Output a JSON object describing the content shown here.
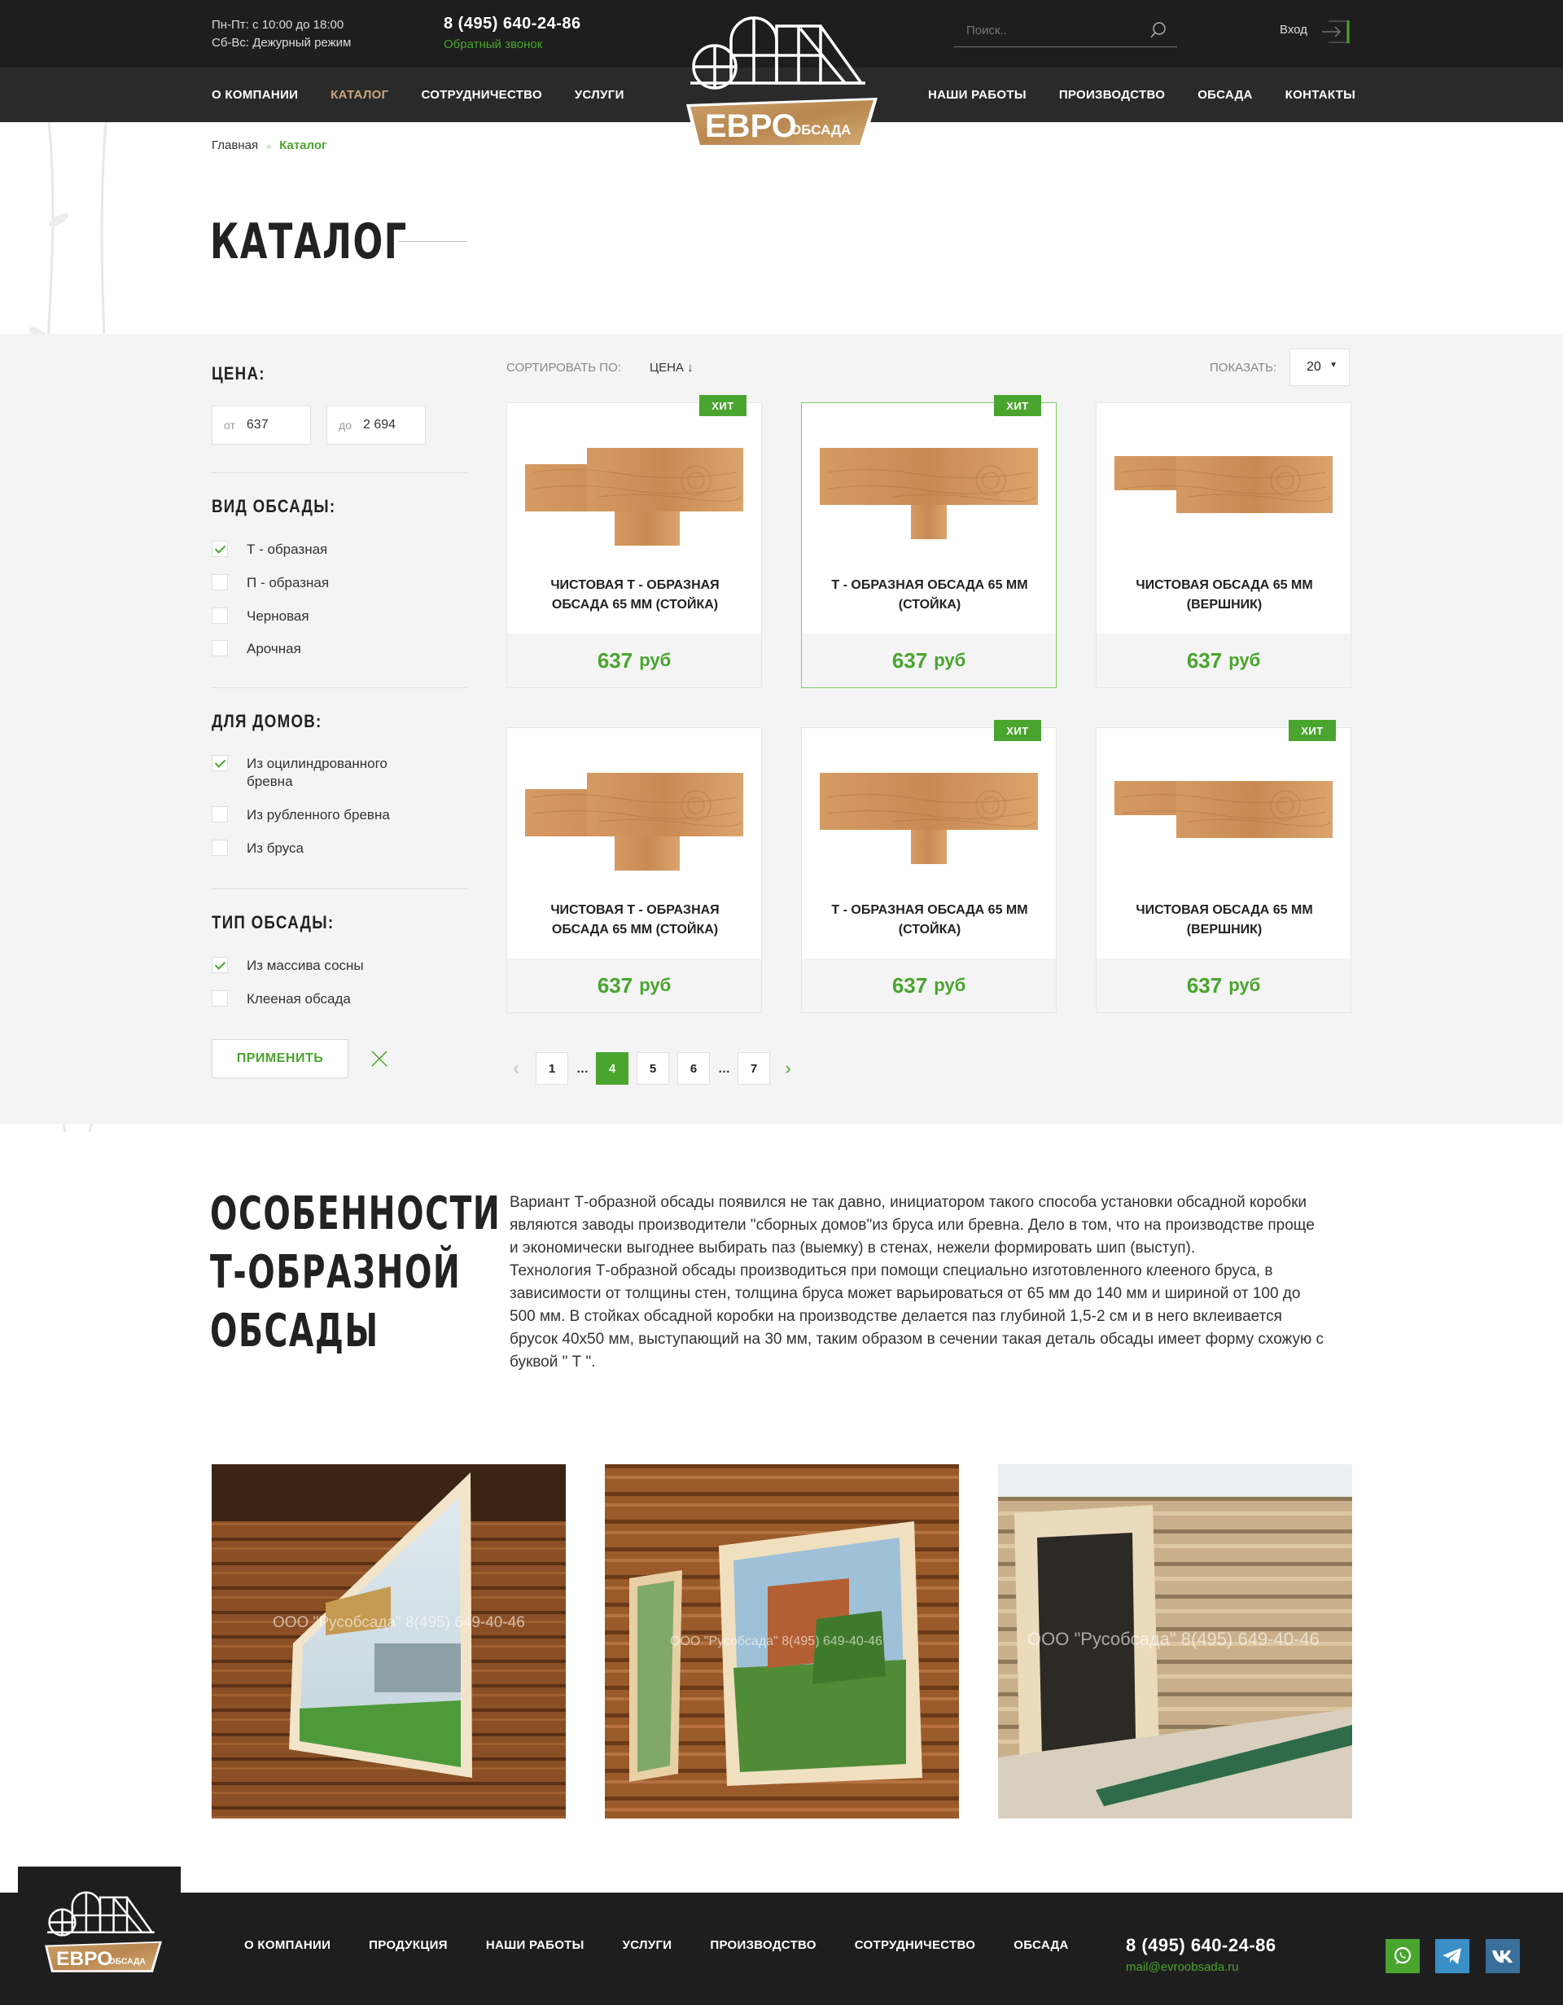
{
  "header": {
    "hours_weekdays": "Пн-Пт: с 10:00 до 18:00",
    "hours_weekend": "Сб-Вс: Дежурный режим",
    "phone": "8 (495) 640-24-86",
    "callback": "Обратный звонок",
    "search_placeholder": "Поиск..",
    "login": "Вход",
    "logo_main": "ЕВРО",
    "logo_sub": "ОБСАДА",
    "nav_left": [
      "О КОМПАНИИ",
      "КАТАЛОГ",
      "СОТРУДНИЧЕСТВО",
      "УСЛУГИ"
    ],
    "nav_right": [
      "НАШИ РАБОТЫ",
      "ПРОИЗВОДСТВО",
      "ОБСАДА",
      "КОНТАКТЫ"
    ]
  },
  "breadcrumb": {
    "home": "Главная",
    "current": "Каталог"
  },
  "page_title": "КАТАЛОГ",
  "filters": {
    "price_title": "ЦЕНА:",
    "price_from_label": "от",
    "price_from": "637",
    "price_to_label": "до",
    "price_to": "2 694",
    "type_title": "ВИД ОБСАДЫ:",
    "type_options": [
      {
        "label": "Т - образная",
        "checked": true
      },
      {
        "label": "П - образная",
        "checked": false
      },
      {
        "label": "Черновая",
        "checked": false
      },
      {
        "label": "Арочная",
        "checked": false
      }
    ],
    "house_title": "ДЛЯ ДОМОВ:",
    "house_options": [
      {
        "label": "Из оцилиндрованного бревна",
        "checked": true
      },
      {
        "label": "Из рубленного бревна",
        "checked": false
      },
      {
        "label": "Из бруса",
        "checked": false
      }
    ],
    "kind_title": "ТИП ОБСАДЫ:",
    "kind_options": [
      {
        "label": "Из массива сосны",
        "checked": true
      },
      {
        "label": "Клееная обсада",
        "checked": false
      }
    ],
    "apply": "ПРИМЕНИТЬ"
  },
  "sort": {
    "label": "СОРТИРОВАТЬ ПО:",
    "value": "ЦЕНА ↓"
  },
  "show": {
    "label": "ПОКАЗАТЬ:",
    "value": "20"
  },
  "products": [
    {
      "name": "ЧИСТОВАЯ Т - ОБРАЗНАЯ ОБСАДА 65 ММ (СТОЙКА)",
      "price": "637",
      "currency": "руб",
      "hit": "ХИТ",
      "shape": "t-wide"
    },
    {
      "name": "Т - ОБРАЗНАЯ ОБСАДА 65 ММ (СТОЙКА)",
      "price": "637",
      "currency": "руб",
      "hit": "ХИТ",
      "shape": "t"
    },
    {
      "name": "ЧИСТОВАЯ ОБСАДА 65 ММ (ВЕРШНИК)",
      "price": "637",
      "currency": "руб",
      "hit": "",
      "shape": "step"
    },
    {
      "name": "ЧИСТОВАЯ Т - ОБРАЗНАЯ ОБСАДА 65 ММ (СТОЙКА)",
      "price": "637",
      "currency": "руб",
      "hit": "",
      "shape": "t-wide"
    },
    {
      "name": "Т - ОБРАЗНАЯ ОБСАДА 65 ММ (СТОЙКА)",
      "price": "637",
      "currency": "руб",
      "hit": "ХИТ",
      "shape": "t"
    },
    {
      "name": "ЧИСТОВАЯ ОБСАДА 65 ММ (ВЕРШНИК)",
      "price": "637",
      "currency": "руб",
      "hit": "ХИТ",
      "shape": "step"
    }
  ],
  "pagination": [
    "1",
    "…",
    "4",
    "5",
    "6",
    "…",
    "7"
  ],
  "pagination_active": "4",
  "features": {
    "title_l1": "ОСОБЕННОСТИ",
    "title_l2": "Т-ОБРАЗНОЙ",
    "title_l3": "ОБСАДЫ",
    "p1": "Вариант Т-образной обсады появился не так давно, инициатором такого способа установки обсадной коробки являются заводы производители \"сборных домов\"из бруса или бревна. Дело в том, что на производстве проще и экономически выгоднее выбирать паз (выемку) в стенах, нежели формировать шип (выступ).",
    "p2": "Технология Т-образной обсады производиться при помощи специально изготовленного клееного бруса, в зависимости от толщины стен, толщина бруса может варьироваться от 65 мм до 140 мм и шириной от 100 до 500 мм. В стойках обсадной коробки на производстве делается  паз глубиной 1,5-2 см и в него вклеивается брусок 40х50 мм,  выступающий на  30 мм, таким образом в сечении такая деталь обсады имеет форму схожую с буквой \" Т \".",
    "watermarks": [
      "ООО \"Русобсада\" 8(495) 649-40-46",
      "ООО \"Русобсада\" 8(495) 649-40-46",
      "ООО \"Русобсада\" 8(495) 649-40-46"
    ]
  },
  "footer": {
    "nav": [
      "О КОМПАНИИ",
      "ПРОДУКЦИЯ",
      "НАШИ РАБОТЫ",
      "УСЛУГИ",
      "ПРОИЗВОДСТВО",
      "СОТРУДНИЧЕСТВО",
      "ОБСАДА"
    ],
    "phone": "8 (495) 640-24-86",
    "email": "mail@evroobsada.ru"
  },
  "colors": {
    "accent": "#49a52e",
    "dark": "#1e1e1e",
    "nav_active": "#c9a77a",
    "whatsapp": "#49a52e",
    "telegram": "#3a8fc6",
    "vk": "#3a6f9a"
  }
}
